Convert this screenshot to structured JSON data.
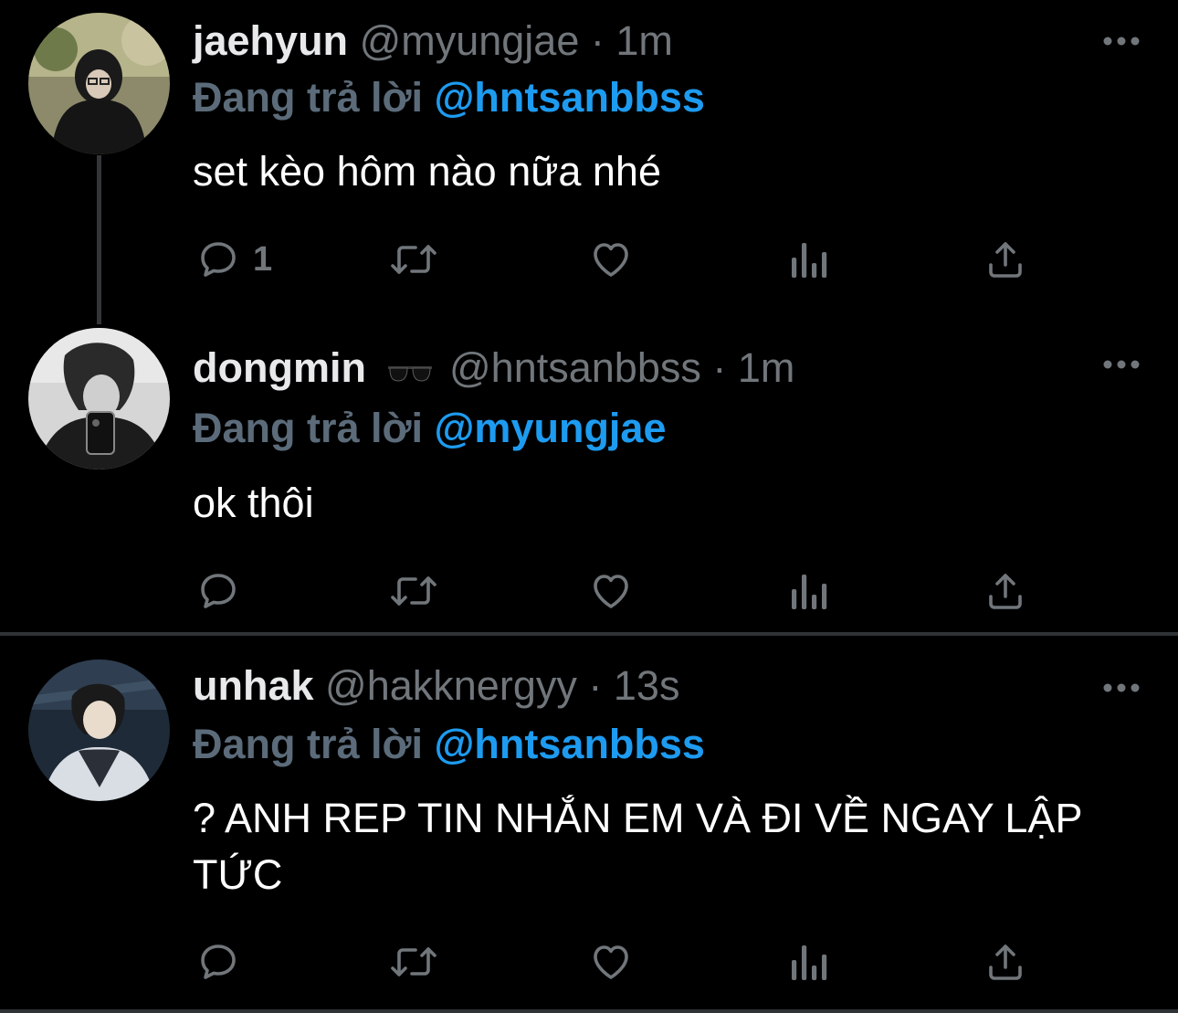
{
  "tweets": [
    {
      "name": "jaehyun",
      "handle": "@myungjae",
      "separator": "·",
      "time": "1m",
      "reply_prefix": "Đang trả lời",
      "reply_to": "@hntsanbbss",
      "text": "set kèo hôm nào nữa nhé",
      "reply_count": "1"
    },
    {
      "name": "dongmin",
      "name_emoji": "sunglasses-icon",
      "handle": "@hntsanbbss",
      "separator": "·",
      "time": "1m",
      "reply_prefix": "Đang trả lời",
      "reply_to": "@myungjae",
      "text": "ok thôi",
      "reply_count": ""
    },
    {
      "name": "unhak",
      "handle": "@hakknergyy",
      "separator": "·",
      "time": "13s",
      "reply_prefix": "Đang trả lời",
      "reply_to": "@hntsanbbss",
      "text": "? ANH REP TIN NHẮN EM VÀ ĐI VỀ NGAY LẬP TỨC",
      "reply_count": ""
    }
  ],
  "colors": {
    "background": "#000000",
    "mention": "#1d9bf0",
    "muted": "#71767b",
    "text": "#ffffff"
  },
  "icons": {
    "reply": "speech-bubble-icon",
    "retweet": "retweet-icon",
    "like": "heart-icon",
    "views": "bar-chart-icon",
    "share": "share-icon",
    "more": "more-dots-icon"
  }
}
